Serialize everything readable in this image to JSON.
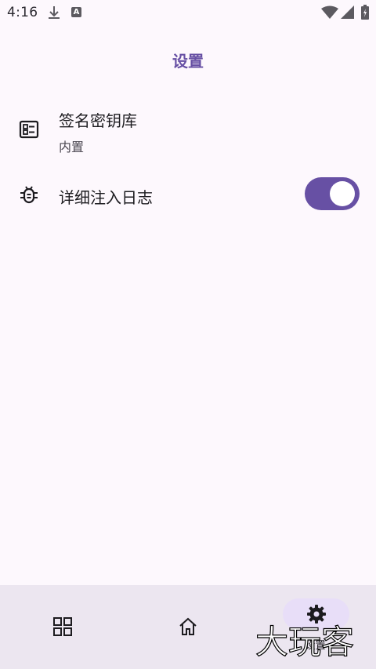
{
  "status_bar": {
    "time": "4:16",
    "badge": "A"
  },
  "top_bar": {
    "title": "设置"
  },
  "settings": {
    "keystore": {
      "title": "签名密钥库",
      "subtitle": "内置",
      "icon": "keystore-list-icon"
    },
    "verbose_log": {
      "title": "详细注入日志",
      "icon": "bug-icon",
      "enabled": true
    }
  },
  "bottom_nav": {
    "items": [
      {
        "icon": "apps-grid-icon",
        "label": ""
      },
      {
        "icon": "home-icon",
        "label": ""
      },
      {
        "icon": "gear-icon",
        "label": "设置",
        "selected": true
      }
    ]
  },
  "watermark": {
    "text": "大玩客"
  },
  "colors": {
    "accent": "#6750a4",
    "background": "#fdf8fd",
    "nav_background": "#ece6f0",
    "nav_indicator": "#e8def8"
  }
}
